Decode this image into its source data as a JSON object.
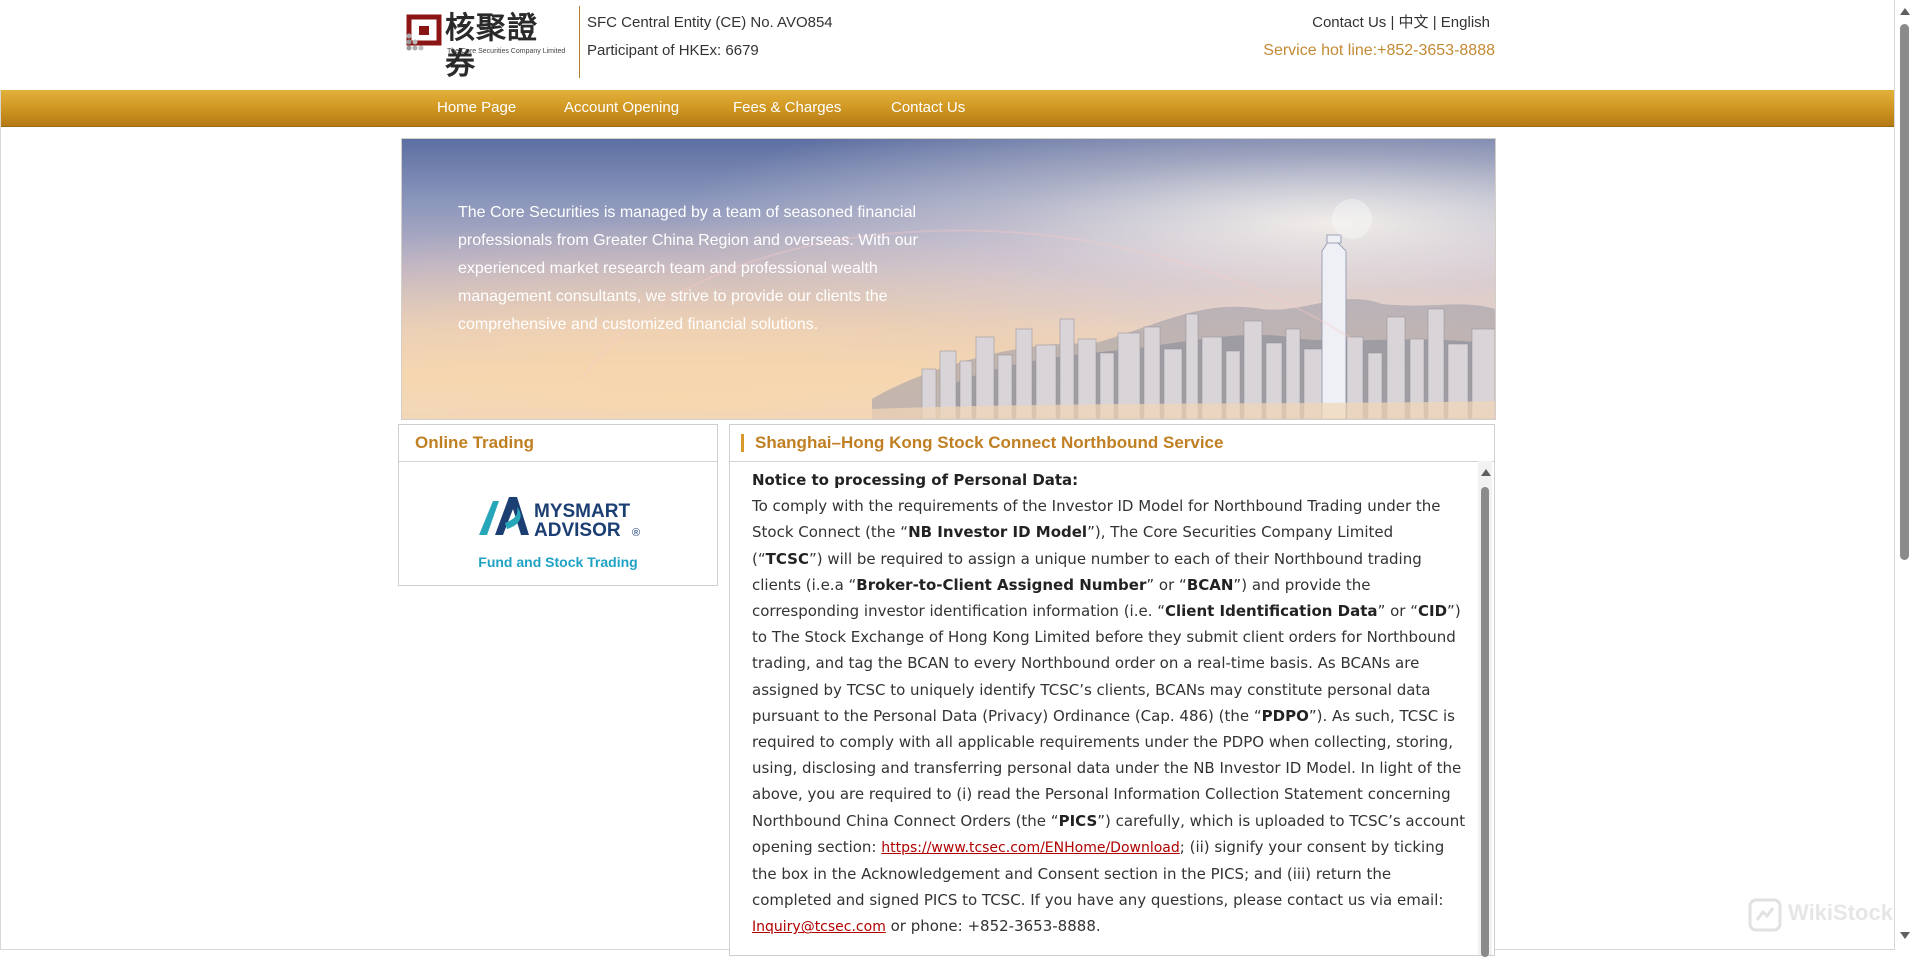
{
  "header": {
    "logo_text_cn": "核聚證券",
    "logo_text_en": "The Core Securities Company Limited",
    "registration_line1": "SFC Central Entity (CE) No. AVO854",
    "registration_line2": "Participant of HKEx: 6679",
    "top_links": {
      "contact": "Contact Us",
      "sep1": " | ",
      "chinese": "中文",
      "sep2": " | ",
      "english": "English"
    },
    "hotline": "Service hot line:+852-3653-8888"
  },
  "nav": {
    "items": [
      {
        "label": "Home Page"
      },
      {
        "label": "Account Opening"
      },
      {
        "label": "Fees & Charges"
      },
      {
        "label": "Contact Us"
      }
    ]
  },
  "banner": {
    "text": "The Core Securities is managed by a team of seasoned financial professionals from Greater China Region and overseas. With our experienced market research team and professional wealth management consultants, we strive to provide our clients the comprehensive and customized financial solutions."
  },
  "online_trading": {
    "title": "Online Trading",
    "logo_line1": "MYSMART",
    "logo_line2": "ADVISOR",
    "logo_mark": "®",
    "subtitle": "Fund and Stock Trading"
  },
  "main": {
    "title": "Shanghai–Hong Kong Stock Connect Northbound Service",
    "notice_heading": "Notice to processing of Personal Data:",
    "para": {
      "t1": "To comply with the requirements of the Investor ID Model for Northbound Trading under the Stock Connect (the “",
      "b1": "NB Investor ID Model",
      "t2": "”), The Core Securities Company Limited (“",
      "b2": "TCSC",
      "t3": "”) will be required to assign a unique number to each of their Northbound trading clients (i.e.a “",
      "b3": "Broker-to-Client Assigned Number",
      "t4": "” or “",
      "b4": "BCAN",
      "t5": "”) and provide the corresponding investor identification information (i.e. “",
      "b5": "Client Identification Data",
      "t6": "” or “",
      "b6": "CID",
      "t7": "”) to The Stock Exchange of Hong Kong Limited before they submit client orders for Northbound trading, and tag the BCAN to every Northbound order on a real-time basis. As BCANs are assigned by TCSC to uniquely identify TCSC’s clients, BCANs may constitute personal data pursuant to the Personal Data (Privacy) Ordinance (Cap. 486) (the “",
      "b7": "PDPO",
      "t8": "”). As such, TCSC is required to comply with all applicable requirements under the PDPO when collecting, storing, using, disclosing and transferring personal data under the NB Investor ID Model. In light of the above, you are required to (i) read the Personal Information Collection Statement concerning Northbound China Connect Orders (the “",
      "b8": "PICS",
      "t9": "”) carefully, which is uploaded to TCSC’s account opening section: ",
      "link1": "https://www.tcsec.com/ENHome/Download",
      "t10": "; (ii) signify your consent by ticking the box in the Acknowledgement and Consent section in the PICS; and (iii) return the completed and signed PICS to TCSC. If you have any questions, please contact us via email: ",
      "link2": "Inquiry@tcsec.com",
      "t11": " or phone: +852-3653-8888."
    }
  },
  "watermark": "WikiStock",
  "colors": {
    "accent": "#c07f22",
    "nav": "#d29a24",
    "link": "#b00000",
    "teal": "#1fa2c4"
  }
}
